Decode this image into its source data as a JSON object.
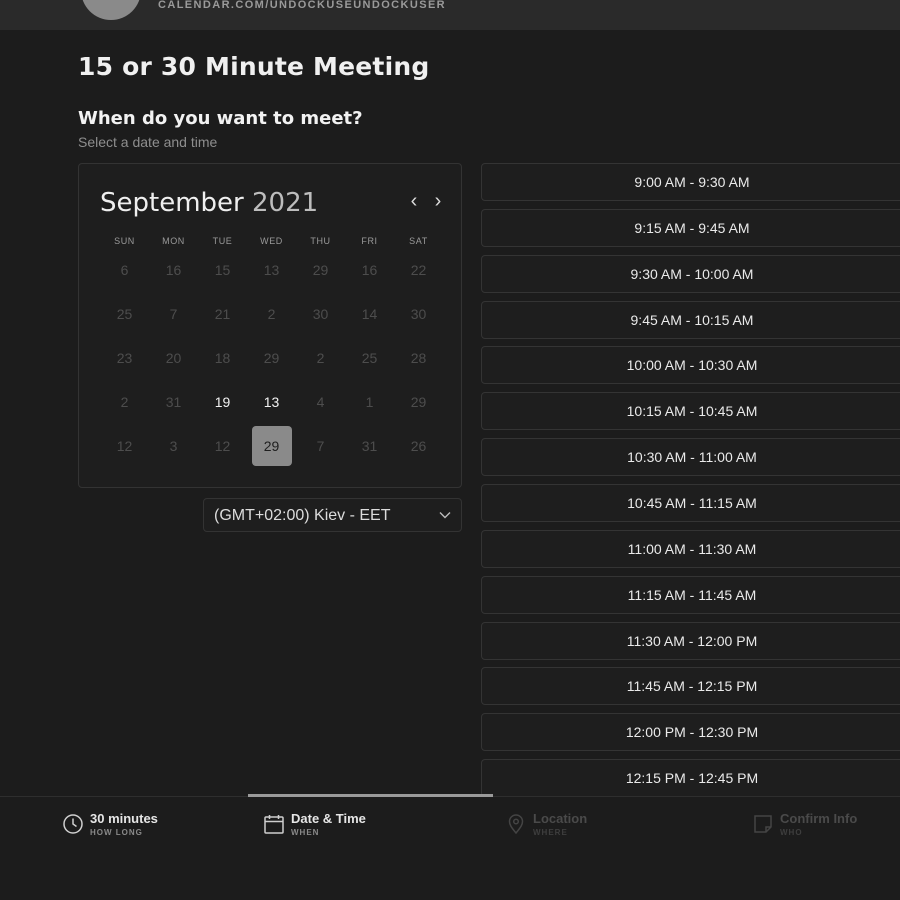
{
  "header": {
    "url": "CALENDAR.COM/UNDOCKUSEUNDOCKUSER"
  },
  "page": {
    "title": "15 or 30 Minute Meeting",
    "section_title": "When do you want to meet?",
    "section_subtitle": "Select a date and time"
  },
  "calendar": {
    "month": "September",
    "year": "2021",
    "prev_icon": "chevron-left-icon",
    "next_icon": "chevron-right-icon",
    "weekdays": [
      "SUN",
      "MON",
      "TUE",
      "WED",
      "THU",
      "FRI",
      "SAT"
    ],
    "weeks": [
      [
        {
          "d": "6"
        },
        {
          "d": "16"
        },
        {
          "d": "15"
        },
        {
          "d": "13"
        },
        {
          "d": "29"
        },
        {
          "d": "16"
        },
        {
          "d": "22"
        }
      ],
      [
        {
          "d": "25"
        },
        {
          "d": "7"
        },
        {
          "d": "21"
        },
        {
          "d": "2"
        },
        {
          "d": "30"
        },
        {
          "d": "14"
        },
        {
          "d": "30"
        }
      ],
      [
        {
          "d": "23"
        },
        {
          "d": "20"
        },
        {
          "d": "18"
        },
        {
          "d": "29"
        },
        {
          "d": "2"
        },
        {
          "d": "25"
        },
        {
          "d": "28"
        }
      ],
      [
        {
          "d": "2"
        },
        {
          "d": "31"
        },
        {
          "d": "19",
          "active": true
        },
        {
          "d": "13",
          "active": true
        },
        {
          "d": "4"
        },
        {
          "d": "1"
        },
        {
          "d": "29"
        }
      ],
      [
        {
          "d": "12"
        },
        {
          "d": "3"
        },
        {
          "d": "12"
        },
        {
          "d": "29",
          "active": true,
          "selected": true
        },
        {
          "d": "7"
        },
        {
          "d": "31"
        },
        {
          "d": "26"
        }
      ]
    ]
  },
  "timezone": {
    "label": "(GMT+02:00) Kiev - EET",
    "icon": "chevron-down-icon"
  },
  "slots": [
    "9:00 AM - 9:30 AM",
    "9:15 AM - 9:45 AM",
    "9:30 AM - 10:00 AM",
    "9:45 AM - 10:15 AM",
    "10:00 AM - 10:30 AM",
    "10:15 AM - 10:45 AM",
    "10:30 AM - 11:00 AM",
    "10:45 AM - 11:15 AM",
    "11:00 AM - 11:30 AM",
    "11:15 AM - 11:45 AM",
    "11:30 AM - 12:00 PM",
    "11:45 AM - 12:15 PM",
    "12:00 PM - 12:30 PM",
    "12:15 PM - 12:45 PM"
  ],
  "steps": [
    {
      "label": "30 minutes",
      "sub": "HOW LONG",
      "icon": "clock-icon",
      "active": true
    },
    {
      "label": "Date & Time",
      "sub": "WHEN",
      "icon": "calendar-icon",
      "active": true
    },
    {
      "label": "Location",
      "sub": "WHERE",
      "icon": "location-pin-icon",
      "active": false
    },
    {
      "label": "Confirm Info",
      "sub": "WHO",
      "icon": "note-icon",
      "active": false
    }
  ],
  "colors": {
    "background": "#1c1c1c",
    "selected_day": "#8a8a8a",
    "text": "#e8e8e8",
    "muted": "#4d4d4d"
  }
}
